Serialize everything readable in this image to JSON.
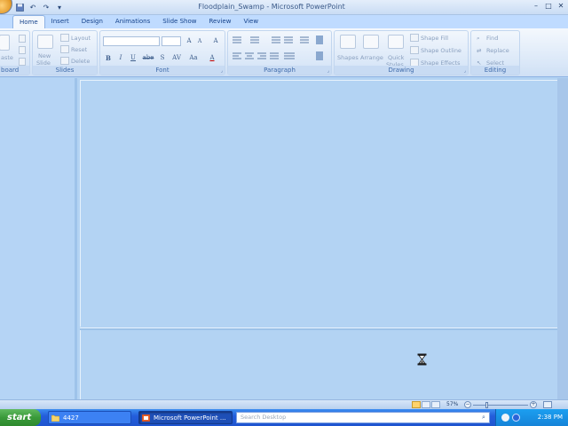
{
  "window": {
    "title": "Floodplain_Swamp - Microsoft PowerPoint",
    "controls": [
      "–",
      "□",
      "✕"
    ]
  },
  "quick_access": [
    "save-icon",
    "undo-icon",
    "redo-icon",
    "customize-icon"
  ],
  "tabs": [
    {
      "label": "Home",
      "active": true
    },
    {
      "label": "Insert"
    },
    {
      "label": "Design"
    },
    {
      "label": "Animations"
    },
    {
      "label": "Slide Show"
    },
    {
      "label": "Review"
    },
    {
      "label": "View"
    }
  ],
  "ribbon": {
    "clipboard": {
      "label": "board",
      "paste": "aste"
    },
    "slides": {
      "label": "Slides",
      "new_slide": "New",
      "new_slide_2": "Slide",
      "layout": "Layout",
      "reset": "Reset",
      "delete": "Delete"
    },
    "font": {
      "label": "Font",
      "bold": "B",
      "italic": "I",
      "underline": "U",
      "strike": "abe",
      "shadow": "S",
      "spacing": "AV",
      "case": "Aa",
      "grow": "A",
      "shrink": "A",
      "clear": "A",
      "color": "A"
    },
    "paragraph": {
      "label": "Paragraph"
    },
    "drawing": {
      "label": "Drawing",
      "shapes": "Shapes",
      "arrange": "Arrange",
      "quick": "Quick",
      "styles": "Styles",
      "shape_fill": "Shape Fill",
      "shape_outline": "Shape Outline",
      "shape_effects": "Shape Effects"
    },
    "editing": {
      "label": "Editing",
      "find": "Find",
      "replace": "Replace",
      "select": "Select"
    }
  },
  "statusbar": {
    "zoom": "57%",
    "zoom_minus": "−",
    "zoom_plus": "+"
  },
  "taskbar": {
    "start": "start",
    "tasks": [
      {
        "label": "4427"
      },
      {
        "label": "Microsoft PowerPoint ..."
      }
    ],
    "search_placeholder": "Search Desktop",
    "clock": "2:38 PM"
  }
}
